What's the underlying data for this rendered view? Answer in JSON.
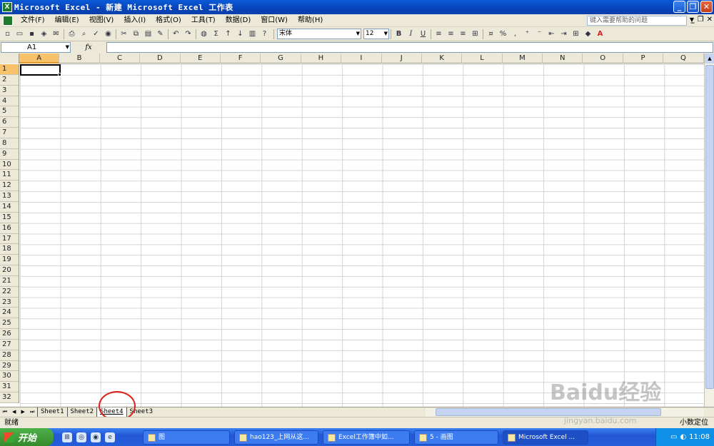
{
  "window": {
    "title": "Microsoft Excel - 新建 Microsoft Excel 工作表",
    "app_icon": "X"
  },
  "menu": {
    "items": [
      "文件(F)",
      "编辑(E)",
      "视图(V)",
      "插入(I)",
      "格式(O)",
      "工具(T)",
      "数据(D)",
      "窗口(W)",
      "帮助(H)"
    ],
    "help_placeholder": "键入需要帮助的问题"
  },
  "toolbar": {
    "font": "宋体",
    "size": "12",
    "bold": "B",
    "italic": "I",
    "underline": "U",
    "percent": "%",
    "sum": "Σ"
  },
  "formula_bar": {
    "name_box": "A1",
    "fx": "fx",
    "value": ""
  },
  "grid": {
    "columns": [
      "A",
      "B",
      "C",
      "D",
      "E",
      "F",
      "G",
      "H",
      "I",
      "J",
      "K",
      "L",
      "M",
      "N",
      "O",
      "P",
      "Q"
    ],
    "rows": [
      "1",
      "2",
      "3",
      "4",
      "5",
      "6",
      "7",
      "8",
      "9",
      "10",
      "11",
      "12",
      "13",
      "14",
      "15",
      "16",
      "17",
      "18",
      "19",
      "20",
      "21",
      "22",
      "23",
      "24",
      "25",
      "26",
      "27",
      "28",
      "29",
      "30",
      "31",
      "32"
    ],
    "active_cell": "A1"
  },
  "sheets": {
    "tabs": [
      "Sheet1",
      "Sheet2",
      "Sheet4",
      "Sheet3"
    ],
    "active": "Sheet4"
  },
  "status": {
    "left": "就绪",
    "right": "小数定位"
  },
  "taskbar": {
    "start": "开始",
    "tasks": [
      "图",
      "hao123_上网从这...",
      "Excel工作簿中如...",
      "5 - 画图",
      "Microsoft Excel ..."
    ],
    "clock": "11:08"
  },
  "watermark": {
    "main": "Baidu经验",
    "sub": "jingyan.baidu.com"
  },
  "colors": {
    "title_blue": "#0a5ad8",
    "active_header": "#f8c26a",
    "annotation_red": "#d8201c"
  }
}
